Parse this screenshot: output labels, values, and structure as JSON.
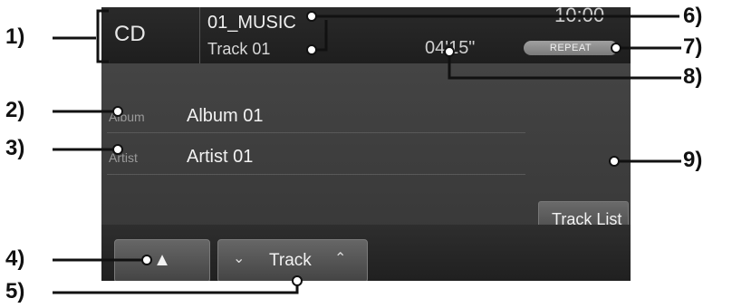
{
  "screen": {
    "source": "CD",
    "folder_name": "01_MUSIC",
    "track_name": "Track 01",
    "clock": "10:00",
    "repeat_label": "REPEAT",
    "elapsed_time": "04'15\"",
    "album_label": "Album",
    "album_value": "Album 01",
    "artist_label": "Artist",
    "artist_value": "Artist 01",
    "track_list_button": "Track List",
    "eject_button": "▲",
    "track_button": "Track",
    "track_down": "⌄",
    "track_up": "⌃"
  },
  "callouts": {
    "n1": "1)",
    "n2": "2)",
    "n3": "3)",
    "n4": "4)",
    "n5": "5)",
    "n6": "6)",
    "n7": "7)",
    "n8": "8)",
    "n9": "9)"
  }
}
